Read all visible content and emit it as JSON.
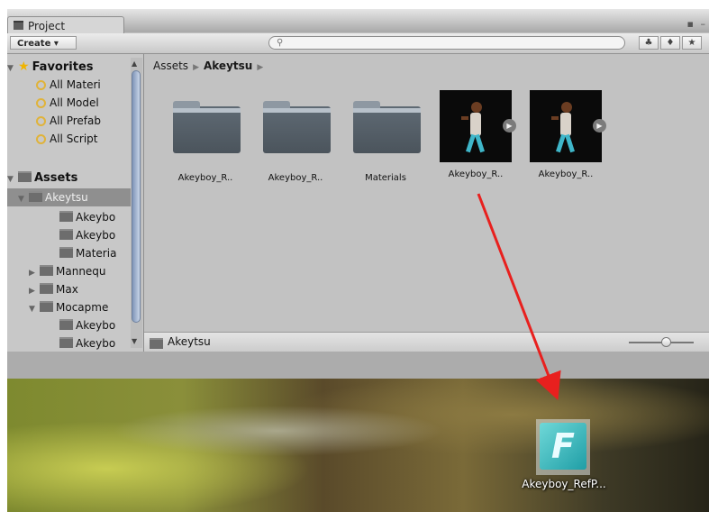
{
  "window": {
    "tab_title": "Project",
    "controls": "▪ –"
  },
  "toolbar": {
    "create_label": "Create ▾",
    "search_placeholder": "",
    "search_icon": "search-icon",
    "buttons": [
      "filter-by-type-icon",
      "filter-by-label-icon",
      "favorite-star-icon"
    ]
  },
  "sidebar": {
    "favorites": {
      "label": "Favorites",
      "items": [
        "All Materi",
        "All Model",
        "All Prefab",
        "All Script"
      ]
    },
    "assets": {
      "label": "Assets",
      "items": [
        {
          "label": "Akeytsu",
          "selected": true
        },
        {
          "label": "Akeybo",
          "selected": false
        },
        {
          "label": "Akeybo",
          "selected": false
        },
        {
          "label": "Materia",
          "selected": false
        },
        {
          "label": "Mannequ",
          "selected": false
        },
        {
          "label": "Max",
          "selected": false
        },
        {
          "label": "Mocapme",
          "selected": false
        },
        {
          "label": "Akeybo",
          "selected": false
        },
        {
          "label": "Akeybo",
          "selected": false
        }
      ]
    }
  },
  "breadcrumb": {
    "root": "Assets",
    "current": "Akeytsu"
  },
  "assets_grid": [
    {
      "label": "Akeyboy_R..",
      "kind": "folder"
    },
    {
      "label": "Akeyboy_R..",
      "kind": "folder"
    },
    {
      "label": "Materials",
      "kind": "folder"
    },
    {
      "label": "Akeyboy_R..",
      "kind": "model"
    },
    {
      "label": "Akeyboy_R..",
      "kind": "model"
    }
  ],
  "footer": {
    "path_label": "Akeytsu",
    "zoom_slider_value": 0.55
  },
  "desktop": {
    "file_label": "Akeyboy_RefP...",
    "file_icon_letter": "F",
    "accent_colors": {
      "arrow": "#e8201e",
      "file_icon": "#2aa8b0"
    }
  }
}
